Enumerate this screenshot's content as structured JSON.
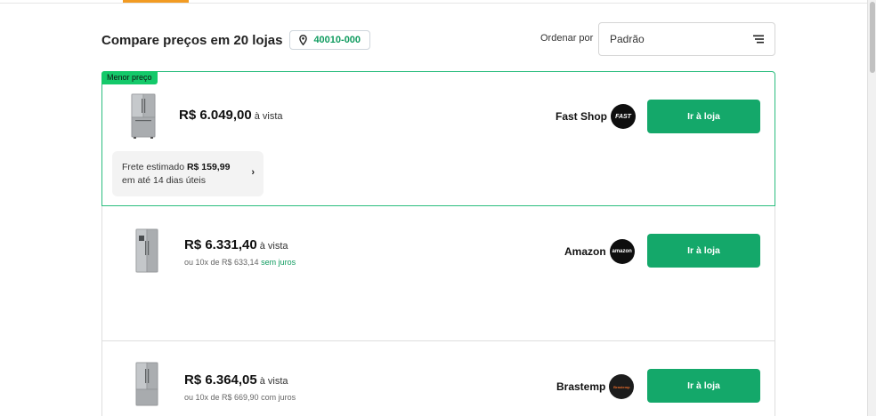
{
  "header": {
    "title": "Compare preços em 20 lojas",
    "cep": "40010-000",
    "sort_label": "Ordenar por",
    "sort_value": "Padrão"
  },
  "offers": [
    {
      "badge": "Menor preço",
      "price": "R$ 6.049,00",
      "cash_label": "à vista",
      "shipping_prefix": "Frete estimado",
      "shipping_value": "R$ 159,99",
      "shipping_eta": "em até 14 dias úteis",
      "store": "Fast Shop",
      "logo_text": "FAST",
      "cta": "Ir à loja"
    },
    {
      "price": "R$ 6.331,40",
      "cash_label": "à vista",
      "installment": "ou 10x de R$ 633,14",
      "installment_note": "sem juros",
      "store": "Amazon",
      "logo_text": "amazon",
      "cta": "Ir à loja"
    },
    {
      "price": "R$ 6.364,05",
      "cash_label": "à vista",
      "installment": "ou 10x de R$ 669,90 com juros",
      "store": "Brastemp",
      "logo_text": "Brastemp",
      "cta": "Ir à loja"
    }
  ],
  "colors": {
    "accent_green": "#14a86a",
    "badge_green": "#14c96a",
    "tab_orange": "#f29b22"
  }
}
